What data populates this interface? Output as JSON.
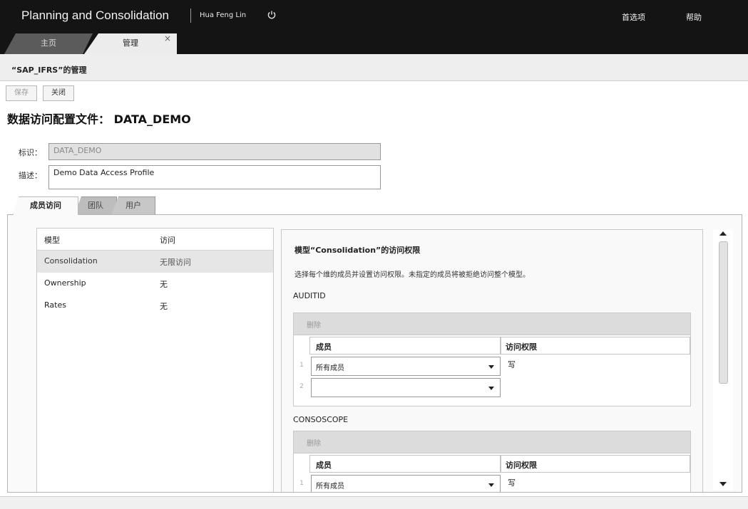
{
  "header": {
    "app_title": "Planning and Consolidation",
    "user_name": "Hua Feng Lin",
    "links": [
      "首选项",
      "帮助"
    ],
    "tabs": [
      {
        "label": "主页"
      },
      {
        "label": "管理"
      }
    ],
    "tab_close": "×"
  },
  "breadcrumb": "“SAP_IFRS”的管理",
  "toolbar": {
    "save_label": "保存",
    "close_label": "关闭"
  },
  "page_title": "数据访问配置文件： DATA_DEMO",
  "form": {
    "id_label": "标识：",
    "id_value": "DATA_DEMO",
    "desc_label": "描述：",
    "desc_value": "Demo Data Access Profile"
  },
  "subtabs": [
    {
      "label": "成员访问"
    },
    {
      "label": "团队"
    },
    {
      "label": "用户"
    }
  ],
  "model_table": {
    "headers": [
      "模型",
      "访问"
    ],
    "rows": [
      {
        "model": "Consolidation",
        "access": "无限访问"
      },
      {
        "model": "Ownership",
        "access": "无"
      },
      {
        "model": "Rates",
        "access": "无"
      }
    ]
  },
  "detail": {
    "title": "模型“Consolidation”的访问权限",
    "instruction": "选择每个维的成员并设置访问权限。未指定的成员将被拒绝访问整个模型。",
    "sections": [
      {
        "dimension": "AUDITID",
        "delete_label": "删除",
        "col_member": "成员",
        "col_access": "访问权限",
        "rows": [
          {
            "num": "1",
            "member": "所有成员",
            "access": "写"
          },
          {
            "num": "2",
            "member": "",
            "access": ""
          }
        ]
      },
      {
        "dimension": "CONSOSCOPE",
        "delete_label": "删除",
        "col_member": "成员",
        "col_access": "访问权限",
        "rows": [
          {
            "num": "1",
            "member": "所有成员",
            "access": "写"
          }
        ]
      }
    ]
  },
  "icons": {
    "power": "power-icon",
    "dropdown": "chevron-down-icon",
    "scroll_up": "arrow-up-icon",
    "scroll_down": "arrow-down-icon"
  },
  "colors": {
    "header_bg": "#141414",
    "selected_row": "#e6e6e6"
  }
}
